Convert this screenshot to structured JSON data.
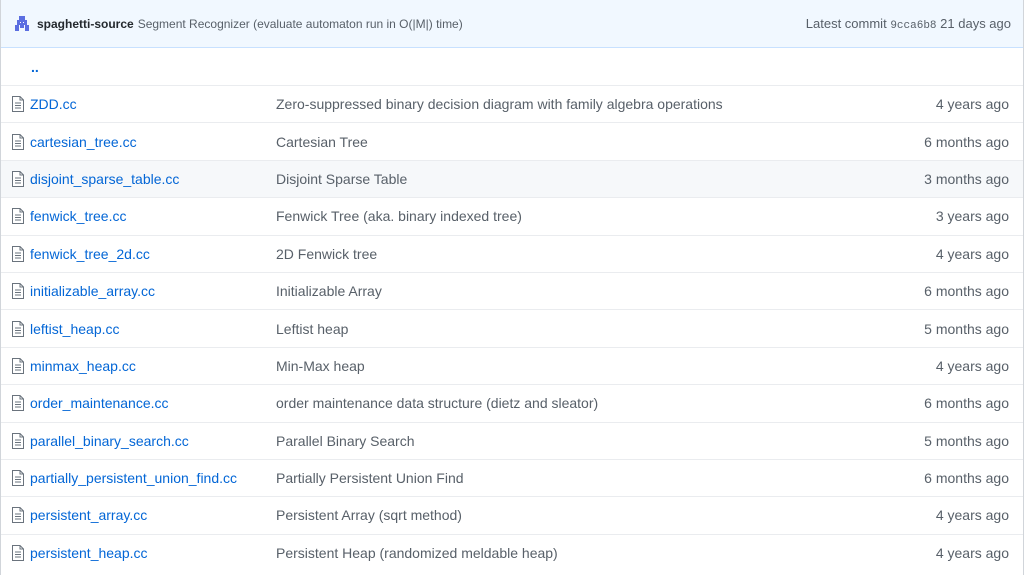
{
  "commit": {
    "author": "spaghetti-source",
    "message": "Segment Recognizer (evaluate automaton run in O(|M|) time)",
    "prefix": "Latest commit",
    "sha": "9cca6b8",
    "age": "21 days ago"
  },
  "parent_link": "..",
  "files": [
    {
      "name": "ZDD.cc",
      "message": "Zero-suppressed binary decision diagram with family algebra operations",
      "age": "4 years ago"
    },
    {
      "name": "cartesian_tree.cc",
      "message": "Cartesian Tree",
      "age": "6 months ago"
    },
    {
      "name": "disjoint_sparse_table.cc",
      "message": "Disjoint Sparse Table",
      "age": "3 months ago"
    },
    {
      "name": "fenwick_tree.cc",
      "message": "Fenwick Tree (aka. binary indexed tree)",
      "age": "3 years ago"
    },
    {
      "name": "fenwick_tree_2d.cc",
      "message": "2D Fenwick tree",
      "age": "4 years ago"
    },
    {
      "name": "initializable_array.cc",
      "message": "Initializable Array",
      "age": "6 months ago"
    },
    {
      "name": "leftist_heap.cc",
      "message": "Leftist heap",
      "age": "5 months ago"
    },
    {
      "name": "minmax_heap.cc",
      "message": "Min-Max heap",
      "age": "4 years ago"
    },
    {
      "name": "order_maintenance.cc",
      "message": "order maintenance data structure (dietz and sleator)",
      "age": "6 months ago"
    },
    {
      "name": "parallel_binary_search.cc",
      "message": "Parallel Binary Search",
      "age": "5 months ago"
    },
    {
      "name": "partially_persistent_union_find.cc",
      "message": "Partially Persistent Union Find",
      "age": "6 months ago"
    },
    {
      "name": "persistent_array.cc",
      "message": "Persistent Array (sqrt method)",
      "age": "4 years ago"
    },
    {
      "name": "persistent_heap.cc",
      "message": "Persistent Heap (randomized meldable heap)",
      "age": "4 years ago"
    }
  ],
  "colors": {
    "link": "#0366d6",
    "muted": "#586069",
    "commit_bar_bg": "#f1f8ff",
    "hover_row_bg": "#f6f8fa"
  },
  "icons": {
    "avatar": "avatar",
    "file": "file-icon"
  }
}
